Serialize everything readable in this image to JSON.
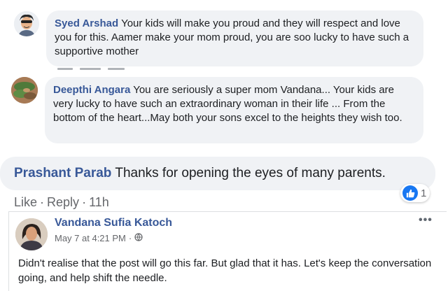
{
  "comments": [
    {
      "author": "Syed Arshad",
      "text": "Your kids will make you proud and they will respect and love you for this. Aamer make your mom proud, you are soo lucky to have such a supportive mother"
    },
    {
      "author": "Deepthi Angara",
      "text": "You are seriously a super mom Vandana... Your kids are very lucky to have such an extraordinary woman in their life ... From the bottom of the heart...May both your sons excel to the heights they wish too."
    },
    {
      "author": "Prashant Parab",
      "text": "Thanks for opening the eyes of many parents.",
      "actions": {
        "like": "Like",
        "reply": "Reply",
        "time": "11h"
      },
      "reaction_count": "1"
    }
  ],
  "reply": {
    "author": "Vandana Sufia Katoch",
    "timestamp": "May 7 at 4:21 PM",
    "more_label": "•••",
    "text": "Didn't realise that the post will go this far. But glad that it has. Let's keep the conversation going, and help shift the needle."
  },
  "colors": {
    "author_link": "#385898",
    "bubble_bg": "#f0f2f5",
    "meta_text": "#65676b",
    "like_blue": "#1877f2"
  },
  "icons": [
    "avatar",
    "avatar",
    "like-icon",
    "avatar",
    "globe-icon",
    "more-icon"
  ]
}
